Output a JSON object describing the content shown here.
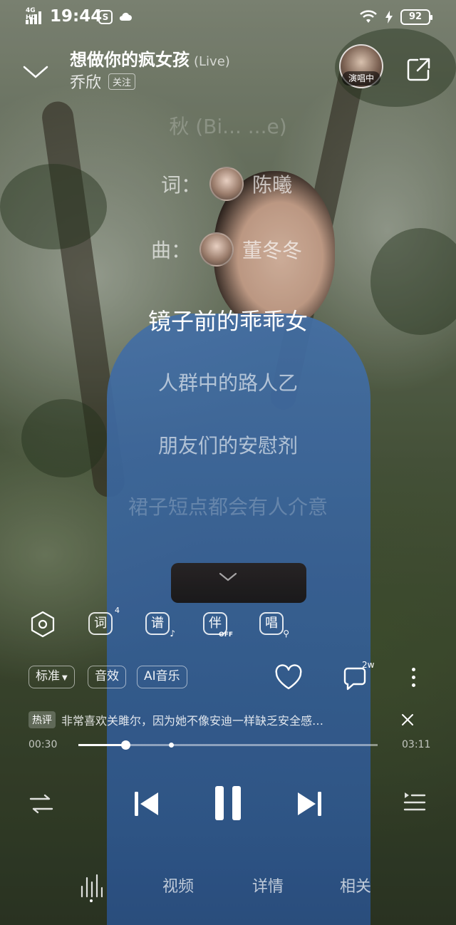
{
  "status_bar": {
    "network": "4G HD",
    "time": "19:44",
    "battery": "92"
  },
  "header": {
    "title": "想做你的疯女孩",
    "title_suffix": "(Live)",
    "artist": "乔欣",
    "follow_label": "关注",
    "concert_badge": "演唱中"
  },
  "lyrics": {
    "faint_top": "秋 (Bi... ...e)",
    "credits": [
      {
        "label": "词：",
        "name": "陈曦"
      },
      {
        "label": "曲：",
        "name": "董冬冬"
      }
    ],
    "lines": [
      {
        "text": "镜子前的乖乖女",
        "state": "current"
      },
      {
        "text": "人群中的路人乙",
        "state": "next"
      },
      {
        "text": "朋友们的安慰剂",
        "state": "next"
      },
      {
        "text": "裙子短点都会有人介意",
        "state": "faint"
      }
    ]
  },
  "func_row": {
    "lyric_badge": "4",
    "lyric_icon_label": "词",
    "score_icon_label": "谱",
    "accompany_icon_label": "伴",
    "accompany_state": "OFF",
    "sing_icon_label": "唱"
  },
  "quality_row": {
    "quality_label": "标准",
    "effects_label": "音效",
    "ai_label": "AI音乐",
    "comment_count": "2w"
  },
  "hot_comment": {
    "tag": "热评",
    "text": "非常喜欢关雎尔，因为她不像安迪一样缺乏安全感…"
  },
  "progress": {
    "elapsed": "00:30",
    "duration": "03:11",
    "played_fraction": 0.157,
    "buffered_fraction": 0.31
  },
  "tabs": {
    "video": "视频",
    "details": "详情",
    "related": "相关"
  }
}
